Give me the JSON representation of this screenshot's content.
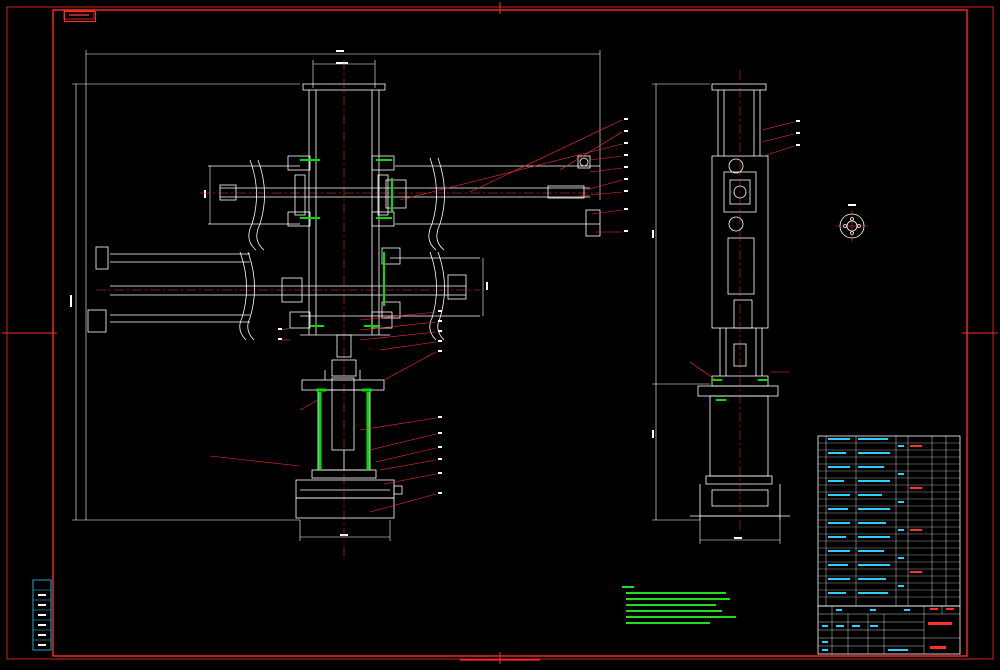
{
  "colors": {
    "background": "#000000",
    "frame": "#ff2a2a",
    "outline": "#ffffff",
    "dimension": "#5ec8ff",
    "leader": "#ff3030",
    "highlight": "#00e000",
    "notes": "#22dd22",
    "table_text": "#2ad0ff"
  },
  "sheet": {
    "corner_label": "",
    "title_block_name": "",
    "drawing_number": ""
  }
}
